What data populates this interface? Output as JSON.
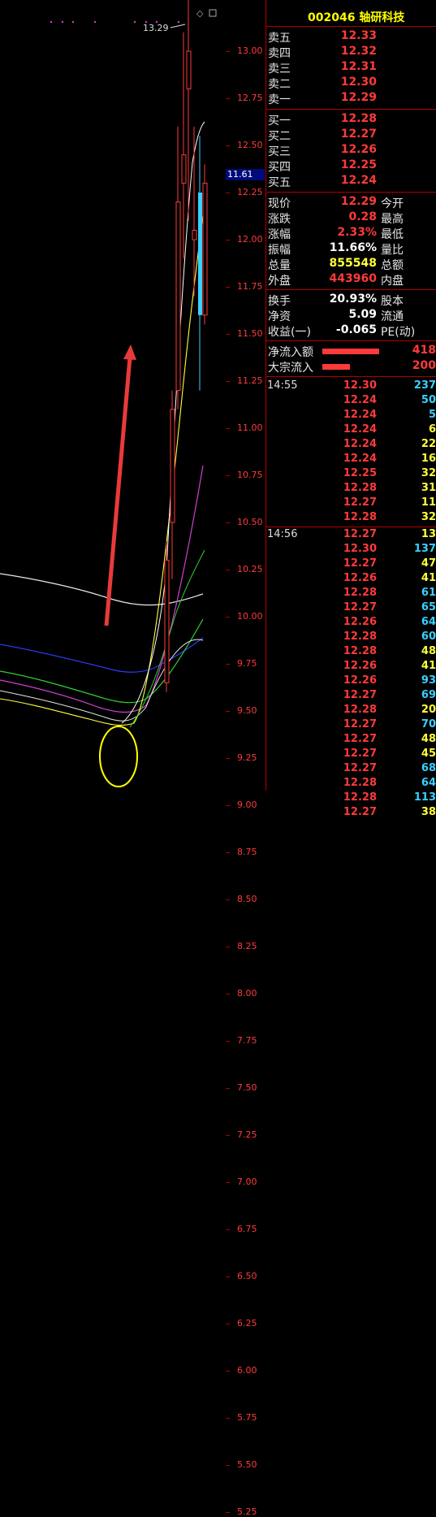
{
  "stock": {
    "code": "002046",
    "name": "轴研科技"
  },
  "chart": {
    "high_label": "13.29",
    "current_price_label": "11.61"
  },
  "axis": {
    "ticks": [
      "13.00",
      "12.75",
      "12.50",
      "12.25",
      "12.00",
      "11.75",
      "11.50",
      "11.25",
      "11.00",
      "10.75",
      "10.50",
      "10.25",
      "10.00",
      "9.75",
      "9.50",
      "9.25",
      "9.00",
      "8.75",
      "8.50",
      "8.25",
      "8.00",
      "7.75",
      "7.50",
      "7.25",
      "7.00",
      "6.75",
      "6.50",
      "6.25",
      "6.00",
      "5.75",
      "5.50",
      "5.25"
    ]
  },
  "order_book": {
    "asks": [
      {
        "label": "卖五",
        "price": "12.33"
      },
      {
        "label": "卖四",
        "price": "12.32"
      },
      {
        "label": "卖三",
        "price": "12.31"
      },
      {
        "label": "卖二",
        "price": "12.30"
      },
      {
        "label": "卖一",
        "price": "12.29"
      }
    ],
    "bids": [
      {
        "label": "买一",
        "price": "12.28"
      },
      {
        "label": "买二",
        "price": "12.27"
      },
      {
        "label": "买三",
        "price": "12.26"
      },
      {
        "label": "买四",
        "price": "12.25"
      },
      {
        "label": "买五",
        "price": "12.24"
      }
    ]
  },
  "stats": [
    {
      "label": "现价",
      "value": "12.29",
      "label2": "今开"
    },
    {
      "label": "涨跌",
      "value": "0.28",
      "label2": "最高"
    },
    {
      "label": "涨幅",
      "value": "2.33%",
      "label2": "最低"
    },
    {
      "label": "振幅",
      "value": "11.66%",
      "label2": "量比"
    },
    {
      "label": "总量",
      "value": "855548",
      "label2": "总额"
    },
    {
      "label": "外盘",
      "value": "443960",
      "label2": "内盘"
    }
  ],
  "fundamentals": [
    {
      "label": "换手",
      "value": "20.93%",
      "label2": "股本"
    },
    {
      "label": "净资",
      "value": "5.09",
      "label2": "流通"
    },
    {
      "label": "收益(一)",
      "value": "-0.065",
      "label2": "PE(动)"
    }
  ],
  "flows": [
    {
      "label": "净流入额",
      "value": "418"
    },
    {
      "label": "大宗流入",
      "value": "200"
    }
  ],
  "ticks_1455": {
    "time": "14:55",
    "rows": [
      {
        "price": "12.30",
        "vol": "237",
        "vc": "cyan"
      },
      {
        "price": "12.24",
        "vol": "50",
        "vc": "cyan"
      },
      {
        "price": "12.24",
        "vol": "5",
        "vc": "cyan"
      },
      {
        "price": "12.24",
        "vol": "6",
        "vc": "yel"
      },
      {
        "price": "12.24",
        "vol": "22",
        "vc": "yel"
      },
      {
        "price": "12.24",
        "vol": "16",
        "vc": "yel"
      },
      {
        "price": "12.25",
        "vol": "32",
        "vc": "yel"
      },
      {
        "price": "12.28",
        "vol": "31",
        "vc": "yel"
      },
      {
        "price": "12.27",
        "vol": "11",
        "vc": "yel"
      },
      {
        "price": "12.28",
        "vol": "32",
        "vc": "yel"
      }
    ]
  },
  "ticks_1456": {
    "time": "14:56",
    "rows": [
      {
        "price": "12.27",
        "vol": "13",
        "vc": "yel"
      },
      {
        "price": "12.30",
        "vol": "137",
        "vc": "cyan"
      },
      {
        "price": "12.27",
        "vol": "47",
        "vc": "yel"
      },
      {
        "price": "12.26",
        "vol": "41",
        "vc": "yel"
      },
      {
        "price": "12.28",
        "vol": "61",
        "vc": "cyan"
      },
      {
        "price": "12.27",
        "vol": "65",
        "vc": "cyan"
      },
      {
        "price": "12.26",
        "vol": "64",
        "vc": "cyan"
      },
      {
        "price": "12.28",
        "vol": "60",
        "vc": "cyan"
      },
      {
        "price": "12.28",
        "vol": "48",
        "vc": "yel"
      },
      {
        "price": "12.26",
        "vol": "41",
        "vc": "yel"
      },
      {
        "price": "12.26",
        "vol": "93",
        "vc": "cyan"
      },
      {
        "price": "12.27",
        "vol": "69",
        "vc": "cyan"
      },
      {
        "price": "12.28",
        "vol": "20",
        "vc": "yel"
      },
      {
        "price": "12.27",
        "vol": "70",
        "vc": "cyan"
      },
      {
        "price": "12.27",
        "vol": "48",
        "vc": "yel"
      },
      {
        "price": "12.27",
        "vol": "45",
        "vc": "yel"
      },
      {
        "price": "12.27",
        "vol": "68",
        "vc": "cyan"
      },
      {
        "price": "12.28",
        "vol": "64",
        "vc": "cyan"
      },
      {
        "price": "12.28",
        "vol": "113",
        "vc": "cyan"
      },
      {
        "price": "12.27",
        "vol": "38",
        "vc": "yel"
      }
    ]
  },
  "colors": {
    "up": "#ff3a3a",
    "down": "#3ad0ff",
    "axis": "#b00000",
    "highlight_circle": "#ffff00",
    "arrow": "#e83a3a"
  }
}
